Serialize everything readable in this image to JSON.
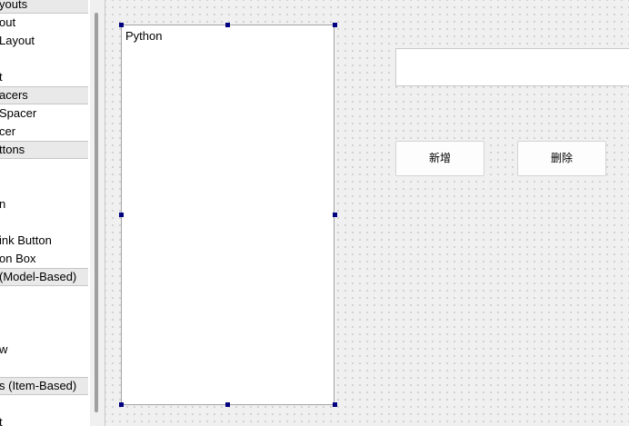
{
  "widget_box": {
    "rows": [
      {
        "label": "youts",
        "category": true
      },
      {
        "label": "out",
        "category": false
      },
      {
        "label": "Layout",
        "category": false
      },
      {
        "label": "",
        "category": false
      },
      {
        "label": "t",
        "category": false
      },
      {
        "label": "acers",
        "category": true
      },
      {
        "label": "Spacer",
        "category": false
      },
      {
        "label": "cer",
        "category": false
      },
      {
        "label": "ttons",
        "category": true
      },
      {
        "label": "",
        "category": false
      },
      {
        "label": "",
        "category": false
      },
      {
        "label": "n",
        "category": false
      },
      {
        "label": "",
        "category": false
      },
      {
        "label": "ink Button",
        "category": false
      },
      {
        "label": "on Box",
        "category": false
      },
      {
        "label": "(Model-Based)",
        "category": true
      },
      {
        "label": "",
        "category": false
      },
      {
        "label": "",
        "category": false
      },
      {
        "label": "",
        "category": false
      },
      {
        "label": "w",
        "category": false
      },
      {
        "label": "",
        "category": false
      },
      {
        "label": "s (Item-Based)",
        "category": true
      },
      {
        "label": "",
        "category": false
      },
      {
        "label": "t",
        "category": false
      }
    ]
  },
  "form": {
    "list_widget": {
      "items": [
        "Python"
      ]
    },
    "line_edit": {
      "value": ""
    },
    "add_button": {
      "label": "新增"
    },
    "delete_button": {
      "label": "删除"
    }
  }
}
